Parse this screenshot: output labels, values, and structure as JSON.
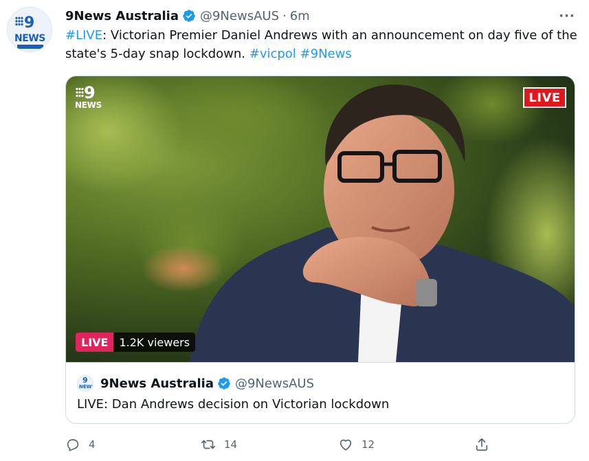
{
  "tweet": {
    "author_name": "9News Australia",
    "handle": "@9NewsAUS",
    "separator": "·",
    "time": "6m",
    "more_label": "···",
    "text_parts": [
      {
        "text": "#LIVE",
        "highlight": true
      },
      {
        "text": ": Victorian Premier Daniel Andrews with an announcement on day five of the state's 5-day snap lockdown. ",
        "highlight": false
      },
      {
        "text": "#vicpol",
        "highlight": true
      },
      {
        "text": " ",
        "highlight": false
      },
      {
        "text": "#9News",
        "highlight": true
      }
    ]
  },
  "avatar": {
    "logo_number": "9",
    "logo_word": "NEWS"
  },
  "video": {
    "logo_number": "9",
    "logo_word": "NEWS",
    "live_badge": "LIVE",
    "pill_live": "LIVE",
    "pill_viewers": "1.2K viewers"
  },
  "card": {
    "author_name": "9News Australia",
    "handle": "@9NewsAUS",
    "title": "LIVE: Dan Andrews decision on Victorian lockdown",
    "avatar_number": "9",
    "avatar_word": "NEWS"
  },
  "actions": {
    "reply_count": "4",
    "retweet_count": "14",
    "like_count": "12"
  },
  "colors": {
    "link": "#1d9bf0",
    "verified": "#1d9bf0",
    "live_red": "#e0181e",
    "muted": "#536471"
  }
}
